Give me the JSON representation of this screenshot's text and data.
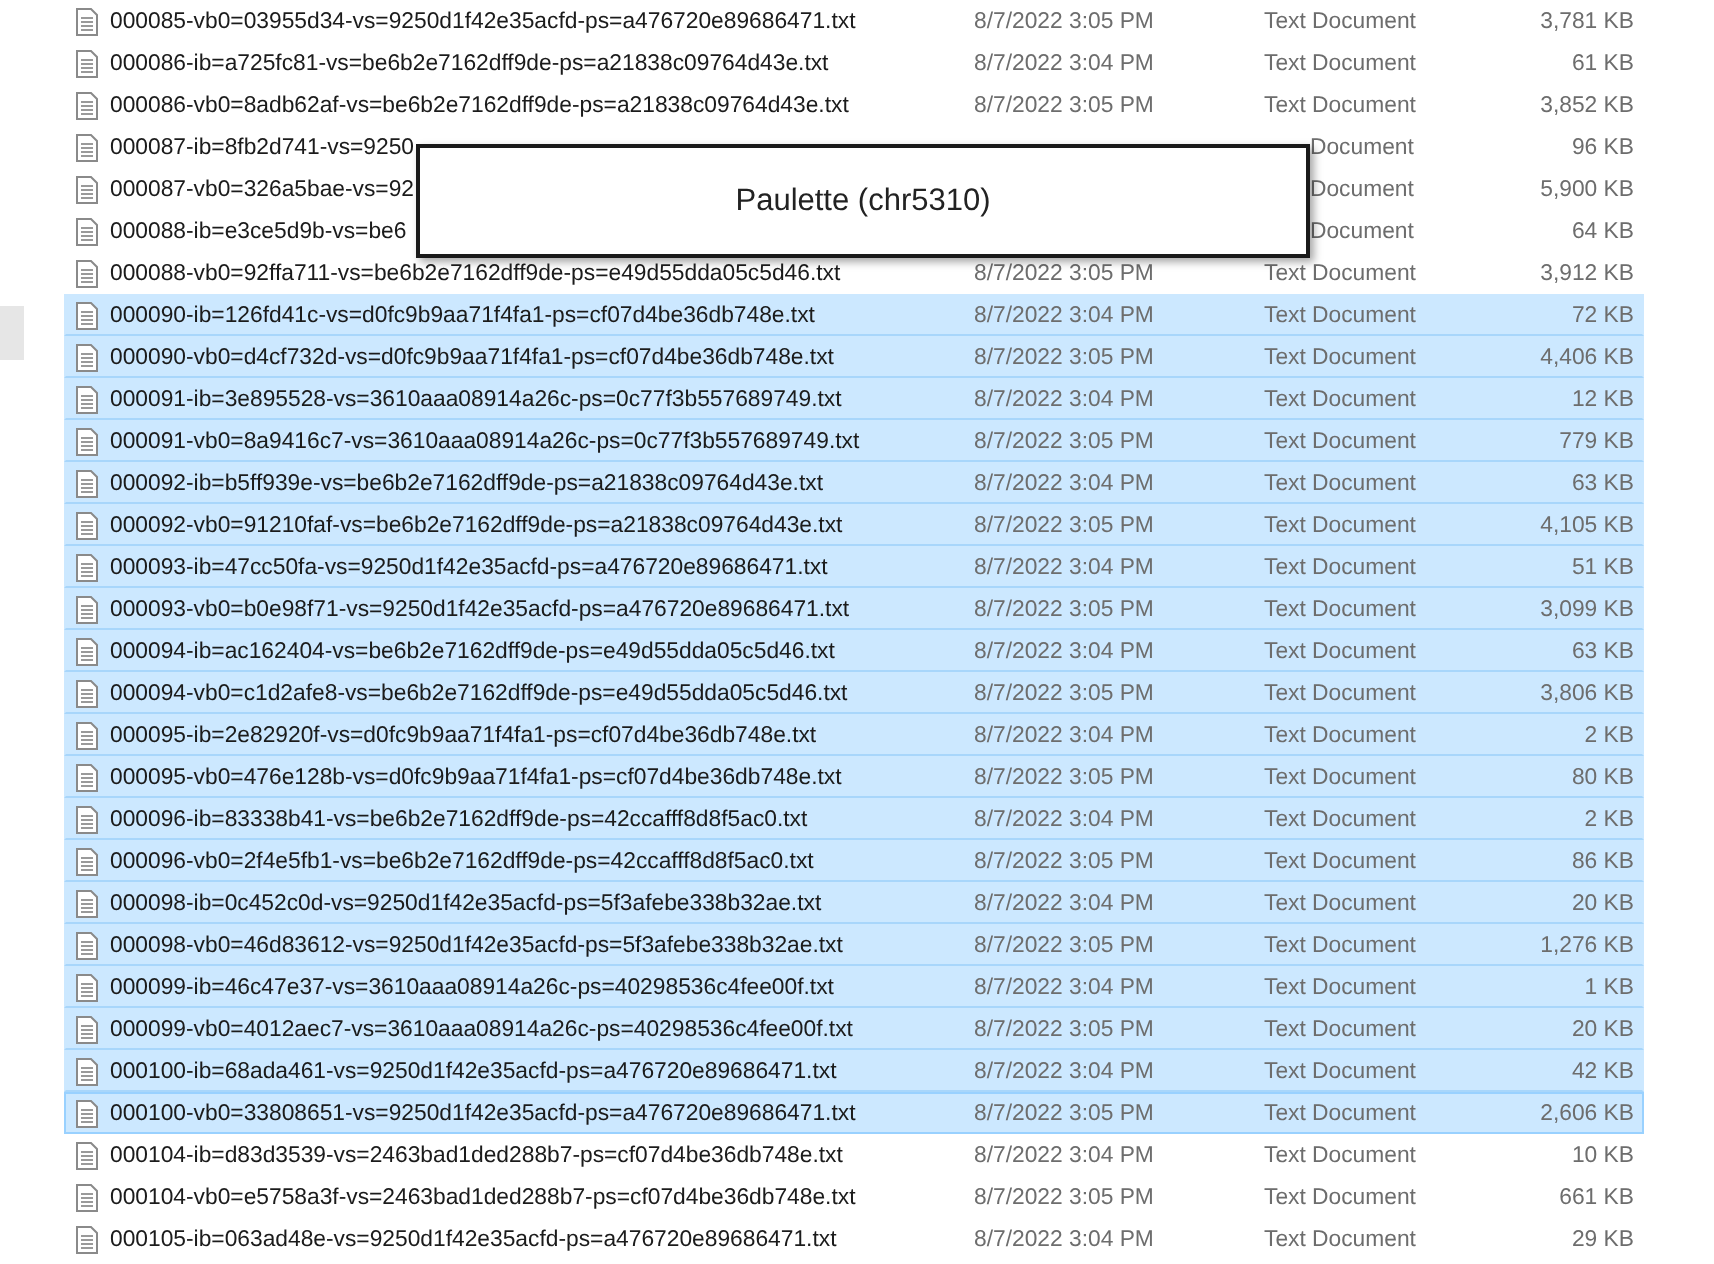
{
  "files": [
    {
      "name": "000085-vb0=03955d34-vs=9250d1f42e35acfd-ps=a476720e89686471.txt",
      "date": "8/7/2022 3:05 PM",
      "type": "Text Document",
      "size": "3,781 KB",
      "selected": false,
      "focused": false
    },
    {
      "name": "000086-ib=a725fc81-vs=be6b2e7162dff9de-ps=a21838c09764d43e.txt",
      "date": "8/7/2022 3:04 PM",
      "type": "Text Document",
      "size": "61 KB",
      "selected": false,
      "focused": false
    },
    {
      "name": "000086-vb0=8adb62af-vs=be6b2e7162dff9de-ps=a21838c09764d43e.txt",
      "date": "8/7/2022 3:05 PM",
      "type": "Text Document",
      "size": "3,852 KB",
      "selected": false,
      "focused": false
    },
    {
      "name": "000087-ib=8fb2d741-vs=9250",
      "type": "Document",
      "size": "96 KB",
      "selected": false,
      "focused": false
    },
    {
      "name": "000087-vb0=326a5bae-vs=92",
      "type": "Document",
      "size": "5,900 KB",
      "selected": false,
      "focused": false
    },
    {
      "name": "000088-ib=e3ce5d9b-vs=be6",
      "type": "Document",
      "size": "64 KB",
      "selected": false,
      "focused": false
    },
    {
      "name": "000088-vb0=92ffa711-vs=be6b2e7162dff9de-ps=e49d55dda05c5d46.txt",
      "date": "8/7/2022 3:05 PM",
      "type": "Text Document",
      "size": "3,912 KB",
      "selected": false,
      "focused": false
    },
    {
      "name": "000090-ib=126fd41c-vs=d0fc9b9aa71f4fa1-ps=cf07d4be36db748e.txt",
      "date": "8/7/2022 3:04 PM",
      "type": "Text Document",
      "size": "72 KB",
      "selected": true,
      "focused": false
    },
    {
      "name": "000090-vb0=d4cf732d-vs=d0fc9b9aa71f4fa1-ps=cf07d4be36db748e.txt",
      "date": "8/7/2022 3:05 PM",
      "type": "Text Document",
      "size": "4,406 KB",
      "selected": true,
      "focused": false
    },
    {
      "name": "000091-ib=3e895528-vs=3610aaa08914a26c-ps=0c77f3b557689749.txt",
      "date": "8/7/2022 3:04 PM",
      "type": "Text Document",
      "size": "12 KB",
      "selected": true,
      "focused": false
    },
    {
      "name": "000091-vb0=8a9416c7-vs=3610aaa08914a26c-ps=0c77f3b557689749.txt",
      "date": "8/7/2022 3:05 PM",
      "type": "Text Document",
      "size": "779 KB",
      "selected": true,
      "focused": false
    },
    {
      "name": "000092-ib=b5ff939e-vs=be6b2e7162dff9de-ps=a21838c09764d43e.txt",
      "date": "8/7/2022 3:04 PM",
      "type": "Text Document",
      "size": "63 KB",
      "selected": true,
      "focused": false
    },
    {
      "name": "000092-vb0=91210faf-vs=be6b2e7162dff9de-ps=a21838c09764d43e.txt",
      "date": "8/7/2022 3:05 PM",
      "type": "Text Document",
      "size": "4,105 KB",
      "selected": true,
      "focused": false
    },
    {
      "name": "000093-ib=47cc50fa-vs=9250d1f42e35acfd-ps=a476720e89686471.txt",
      "date": "8/7/2022 3:04 PM",
      "type": "Text Document",
      "size": "51 KB",
      "selected": true,
      "focused": false
    },
    {
      "name": "000093-vb0=b0e98f71-vs=9250d1f42e35acfd-ps=a476720e89686471.txt",
      "date": "8/7/2022 3:05 PM",
      "type": "Text Document",
      "size": "3,099 KB",
      "selected": true,
      "focused": false
    },
    {
      "name": "000094-ib=ac162404-vs=be6b2e7162dff9de-ps=e49d55dda05c5d46.txt",
      "date": "8/7/2022 3:04 PM",
      "type": "Text Document",
      "size": "63 KB",
      "selected": true,
      "focused": false
    },
    {
      "name": "000094-vb0=c1d2afe8-vs=be6b2e7162dff9de-ps=e49d55dda05c5d46.txt",
      "date": "8/7/2022 3:05 PM",
      "type": "Text Document",
      "size": "3,806 KB",
      "selected": true,
      "focused": false
    },
    {
      "name": "000095-ib=2e82920f-vs=d0fc9b9aa71f4fa1-ps=cf07d4be36db748e.txt",
      "date": "8/7/2022 3:04 PM",
      "type": "Text Document",
      "size": "2 KB",
      "selected": true,
      "focused": false
    },
    {
      "name": "000095-vb0=476e128b-vs=d0fc9b9aa71f4fa1-ps=cf07d4be36db748e.txt",
      "date": "8/7/2022 3:05 PM",
      "type": "Text Document",
      "size": "80 KB",
      "selected": true,
      "focused": false
    },
    {
      "name": "000096-ib=83338b41-vs=be6b2e7162dff9de-ps=42ccafff8d8f5ac0.txt",
      "date": "8/7/2022 3:04 PM",
      "type": "Text Document",
      "size": "2 KB",
      "selected": true,
      "focused": false
    },
    {
      "name": "000096-vb0=2f4e5fb1-vs=be6b2e7162dff9de-ps=42ccafff8d8f5ac0.txt",
      "date": "8/7/2022 3:05 PM",
      "type": "Text Document",
      "size": "86 KB",
      "selected": true,
      "focused": false
    },
    {
      "name": "000098-ib=0c452c0d-vs=9250d1f42e35acfd-ps=5f3afebe338b32ae.txt",
      "date": "8/7/2022 3:04 PM",
      "type": "Text Document",
      "size": "20 KB",
      "selected": true,
      "focused": false
    },
    {
      "name": "000098-vb0=46d83612-vs=9250d1f42e35acfd-ps=5f3afebe338b32ae.txt",
      "date": "8/7/2022 3:05 PM",
      "type": "Text Document",
      "size": "1,276 KB",
      "selected": true,
      "focused": false
    },
    {
      "name": "000099-ib=46c47e37-vs=3610aaa08914a26c-ps=40298536c4fee00f.txt",
      "date": "8/7/2022 3:04 PM",
      "type": "Text Document",
      "size": "1 KB",
      "selected": true,
      "focused": false
    },
    {
      "name": "000099-vb0=4012aec7-vs=3610aaa08914a26c-ps=40298536c4fee00f.txt",
      "date": "8/7/2022 3:05 PM",
      "type": "Text Document",
      "size": "20 KB",
      "selected": true,
      "focused": false
    },
    {
      "name": "000100-ib=68ada461-vs=9250d1f42e35acfd-ps=a476720e89686471.txt",
      "date": "8/7/2022 3:04 PM",
      "type": "Text Document",
      "size": "42 KB",
      "selected": true,
      "focused": false
    },
    {
      "name": "000100-vb0=33808651-vs=9250d1f42e35acfd-ps=a476720e89686471.txt",
      "date": "8/7/2022 3:05 PM",
      "type": "Text Document",
      "size": "2,606 KB",
      "selected": true,
      "focused": true
    },
    {
      "name": "000104-ib=d83d3539-vs=2463bad1ded288b7-ps=cf07d4be36db748e.txt",
      "date": "8/7/2022 3:04 PM",
      "type": "Text Document",
      "size": "10 KB",
      "selected": false,
      "focused": false
    },
    {
      "name": "000104-vb0=e5758a3f-vs=2463bad1ded288b7-ps=cf07d4be36db748e.txt",
      "date": "8/7/2022 3:05 PM",
      "type": "Text Document",
      "size": "661 KB",
      "selected": false,
      "focused": false
    },
    {
      "name": "000105-ib=063ad48e-vs=9250d1f42e35acfd-ps=a476720e89686471.txt",
      "date": "8/7/2022 3:04 PM",
      "type": "Text Document",
      "size": "29 KB",
      "selected": false,
      "focused": false
    }
  ],
  "popup": {
    "text": "Paulette (chr5310)"
  }
}
